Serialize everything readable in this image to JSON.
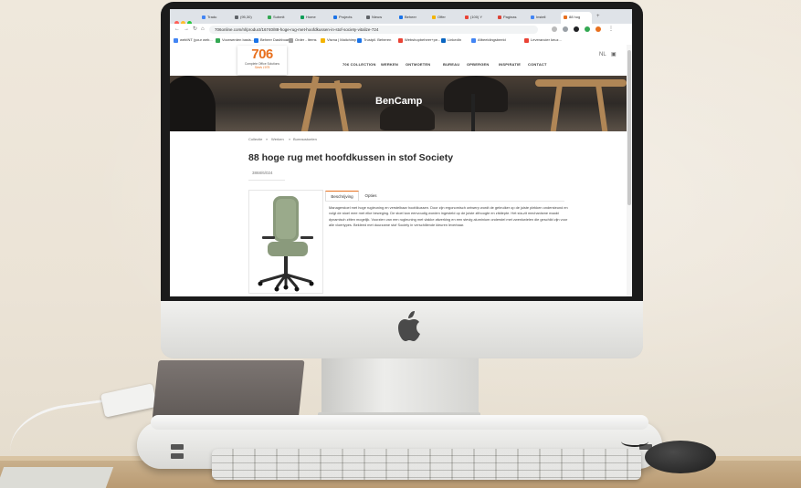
{
  "browser": {
    "tabs": [
      {
        "label": "Tradu",
        "color": "#4285f4"
      },
      {
        "label": "(95,30)",
        "color": "#5f6368"
      },
      {
        "label": "Submit",
        "color": "#34a853"
      },
      {
        "label": "Home",
        "color": "#0f9d58"
      },
      {
        "label": "Projects",
        "color": "#1a73e8"
      },
      {
        "label": "Nieuw",
        "color": "#5f6368"
      },
      {
        "label": "Beheer",
        "color": "#1a73e8"
      },
      {
        "label": "Offer",
        "color": "#f4b400"
      },
      {
        "label": "(100) Y",
        "color": "#ea4335"
      },
      {
        "label": "Paginas",
        "color": "#db4437"
      },
      {
        "label": "Instell",
        "color": "#4285f4"
      },
      {
        "label": "88 hog",
        "color": "#e8701e"
      }
    ],
    "url": "706online.com/nl/product/16740/88-hoge-rug-met-hoofdkussen-in-stof-society-vitalize-724",
    "bookmarks": [
      {
        "label": "webINT (your web...",
        "color": "#4285f4"
      },
      {
        "label": "Voorwerden basis...",
        "color": "#34a853"
      },
      {
        "label": "Beheer Dashboard",
        "color": "#1a73e8"
      },
      {
        "label": "Order - Items",
        "color": "#9e9e9e"
      },
      {
        "label": "Visma | Mailchimp",
        "color": "#f4b400"
      },
      {
        "label": "Trustpil. Beheren",
        "color": "#1a73e8"
      },
      {
        "label": "Webshopbeheer+pe...",
        "color": "#ea4335"
      },
      {
        "label": "LinkedIn",
        "color": "#0a66c2"
      },
      {
        "label": "Afbeeldingsbeeld",
        "color": "#4285f4"
      },
      {
        "label": "Leverancier keuz...",
        "color": "#ea4335"
      }
    ]
  },
  "site": {
    "logo_number": "706",
    "logo_subtitle": "Complete Office Solutions",
    "logo_tagline": "Sinds 1979",
    "menu": [
      "706 COLLECTION",
      "WERKEN",
      "ONTMOETEN",
      "BUREAU",
      "OPBERGEN",
      "INSPIRATIE",
      "CONTACT"
    ],
    "hero_title": "BenCamp",
    "breadcrumb": [
      "Collectie",
      "Werken",
      "Bureaustoelen"
    ],
    "product_title": "88 hoge rug met hoofdkussen in stof Society",
    "sku": "3868/6/024",
    "tabs": [
      "Beschrijving",
      "Opties"
    ],
    "description": "Managerstoel met hoge rugleuning en verstelbaar hoofdkussen. Door zijn ergonomisch ontwerp wordt de gebruiker op de juiste plekken ondersteund en volgt de stoel mee met elke beweging. De stoel kan eenvoudig worden ingesteld op de juiste zithoogte en zitdiepte. Het sta-zit mechanisme maakt dynamisch zitten mogelijk. Voorzien van een rugleuning met vlakke afwerking en een stevig aluminium onderstel met zwenkwielen die geschikt zijn voor alle vloertypes. Bekleed met duurzame stof Society in verschillende kleuren leverbaar."
  },
  "colors": {
    "brand_orange": "#e8701e",
    "chair_green": "#8a9a7c"
  }
}
